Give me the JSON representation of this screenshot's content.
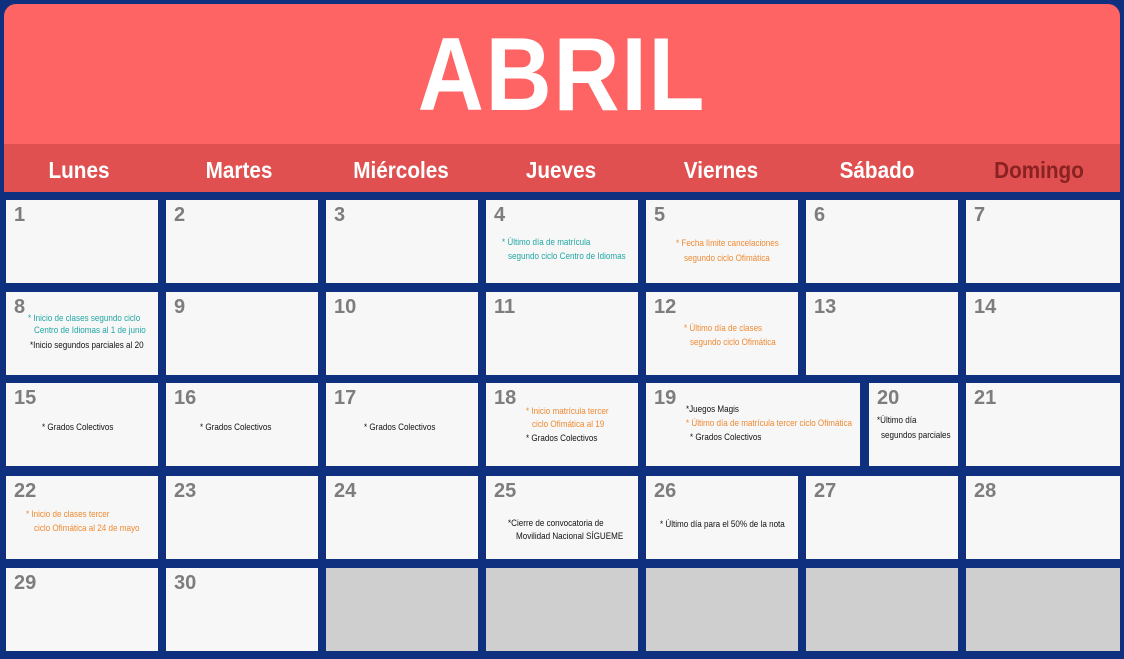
{
  "month": "ABRIL",
  "colors": {
    "header": "#ff6464",
    "days_bar": "#e05050",
    "frame": "#0f2f7f",
    "teal": "#22a7a4",
    "orange": "#ee8a32"
  },
  "weekdays": [
    "Lunes",
    "Martes",
    "Miércoles",
    "Jueves",
    "Viernes",
    "Sábado",
    "Domingo"
  ],
  "days": {
    "d1": "1",
    "d2": "2",
    "d3": "3",
    "d4": "4",
    "d5": "5",
    "d6": "6",
    "d7": "7",
    "d8": "8",
    "d9": "9",
    "d10": "10",
    "d11": "11",
    "d12": "12",
    "d13": "13",
    "d14": "14",
    "d15": "15",
    "d16": "16",
    "d17": "17",
    "d18": "18",
    "d19": "19",
    "d20": "20",
    "d21": "21",
    "d22": "22",
    "d23": "23",
    "d24": "24",
    "d25": "25",
    "d26": "26",
    "d27": "27",
    "d28": "28",
    "d29": "29",
    "d30": "30"
  },
  "events": {
    "d4_1": "* Último día de matrícula",
    "d4_2": "segundo ciclo Centro de Idiomas",
    "d5_1": "* Fecha límite cancelaciones",
    "d5_2": "segundo ciclo Ofimática",
    "d8_1": "* Inicio de clases segundo ciclo",
    "d8_2": "Centro de Idiomas al 1 de junio",
    "d8_3": "*Inicio segundos parciales al 20",
    "d12_1": "* Último día de clases",
    "d12_2": "segundo ciclo Ofimática",
    "d15_1": "* Grados Colectivos",
    "d16_1": "* Grados Colectivos",
    "d17_1": "* Grados Colectivos",
    "d18_1": "* Inicio matrícula tercer",
    "d18_2": "ciclo Ofimática al 19",
    "d18_3": "* Grados Colectivos",
    "d19_1": "*Juegos Magis",
    "d19_2": "* Último día de matrícula tercer ciclo Ofimática",
    "d19_3": "* Grados Colectivos",
    "d20_1": "*Último día",
    "d20_2": "segundos  parciales",
    "d22_1": "* Inicio de clases tercer",
    "d22_2": "ciclo Ofimática al 24 de mayo",
    "d25_1": "*Cierre de convocatoria de",
    "d25_2": "Movilidad Nacional SÍGUEME",
    "d26_1": "* Último día para el 50% de la nota"
  }
}
